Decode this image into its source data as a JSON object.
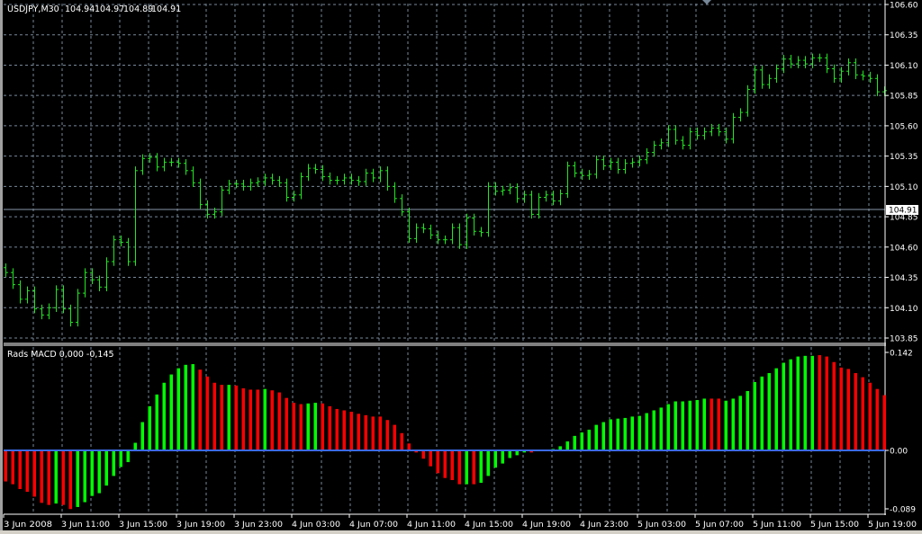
{
  "chart_data": [
    {
      "type": "ohlc",
      "title": "USDJPY,M30",
      "header_values": {
        "open": "104.94",
        "high": "104.97",
        "low": "104.89",
        "close": "104.91"
      },
      "current_price_label": "104.91",
      "current_price": 104.91,
      "ylim": [
        103.85,
        106.6
      ],
      "y_ticks": [
        "106.60",
        "106.35",
        "106.10",
        "105.85",
        "105.60",
        "105.35",
        "105.10",
        "104.85",
        "104.60",
        "104.35",
        "104.10",
        "103.85"
      ],
      "y_tick_values": [
        106.6,
        106.35,
        106.1,
        105.85,
        105.6,
        105.35,
        105.1,
        104.85,
        104.6,
        104.35,
        104.1,
        103.85
      ],
      "grid": true,
      "bar_color": "#22e622",
      "close": [
        104.39,
        104.29,
        104.17,
        104.24,
        104.09,
        104.04,
        104.1,
        104.25,
        104.09,
        103.98,
        104.22,
        104.39,
        104.33,
        104.27,
        104.48,
        104.66,
        104.64,
        104.48,
        105.23,
        105.33,
        105.34,
        105.26,
        105.3,
        105.3,
        105.29,
        105.23,
        105.13,
        104.95,
        104.87,
        104.89,
        105.07,
        105.12,
        105.12,
        105.1,
        105.13,
        105.14,
        105.17,
        105.15,
        105.13,
        105.01,
        105.03,
        105.18,
        105.25,
        105.24,
        105.18,
        105.15,
        105.15,
        105.17,
        105.15,
        105.14,
        105.21,
        105.17,
        105.23,
        105.1,
        105.0,
        104.89,
        104.67,
        104.76,
        104.75,
        104.7,
        104.66,
        104.66,
        104.76,
        104.62,
        104.84,
        104.73,
        104.72,
        105.1,
        105.06,
        105.07,
        105.09,
        105.0,
        105.03,
        104.87,
        105.01,
        105.03,
        104.98,
        105.04,
        105.27,
        105.21,
        105.19,
        105.2,
        105.32,
        105.27,
        105.3,
        105.24,
        105.29,
        105.3,
        105.32,
        105.38,
        105.44,
        105.46,
        105.57,
        105.48,
        105.44,
        105.55,
        105.52,
        105.55,
        105.58,
        105.55,
        105.49,
        105.67,
        105.71,
        105.9,
        106.06,
        105.94,
        105.99,
        106.07,
        106.15,
        106.11,
        106.14,
        106.11,
        106.16,
        106.16,
        106.07,
        105.99,
        106.05,
        106.12,
        106.02,
        106.01,
        105.99,
        105.88,
        105.89
      ]
    },
    {
      "type": "bar",
      "title": "Rads MACD 0,000 -0,145",
      "ylim": [
        -0.089,
        0.142
      ],
      "y_ticks": [
        "0.142",
        "0.00",
        "-0.089"
      ],
      "y_tick_values": [
        0.142,
        0.0,
        -0.089
      ],
      "zero_line_color": "#3c6ae6",
      "up_color": "#00ff00",
      "down_color": "#ff0000",
      "values": [
        -0.045,
        -0.049,
        -0.056,
        -0.06,
        -0.067,
        -0.076,
        -0.079,
        -0.077,
        -0.079,
        -0.085,
        -0.082,
        -0.075,
        -0.066,
        -0.062,
        -0.051,
        -0.037,
        -0.024,
        -0.017,
        0.011,
        0.041,
        0.064,
        0.081,
        0.098,
        0.11,
        0.119,
        0.124,
        0.125,
        0.117,
        0.107,
        0.098,
        0.095,
        0.095,
        0.094,
        0.09,
        0.088,
        0.088,
        0.089,
        0.087,
        0.084,
        0.076,
        0.069,
        0.067,
        0.068,
        0.069,
        0.068,
        0.064,
        0.06,
        0.058,
        0.056,
        0.053,
        0.051,
        0.049,
        0.049,
        0.044,
        0.037,
        0.025,
        0.01,
        -0.003,
        -0.012,
        -0.023,
        -0.033,
        -0.04,
        -0.043,
        -0.049,
        -0.049,
        -0.049,
        -0.047,
        -0.037,
        -0.025,
        -0.019,
        -0.011,
        -0.007,
        -0.003,
        -0.003,
        0.0,
        0.001,
        0.002,
        0.006,
        0.013,
        0.021,
        0.026,
        0.03,
        0.037,
        0.041,
        0.045,
        0.046,
        0.047,
        0.049,
        0.05,
        0.054,
        0.058,
        0.062,
        0.067,
        0.071,
        0.071,
        0.072,
        0.073,
        0.075,
        0.075,
        0.075,
        0.072,
        0.075,
        0.079,
        0.086,
        0.099,
        0.107,
        0.112,
        0.119,
        0.127,
        0.132,
        0.136,
        0.137,
        0.137,
        0.138,
        0.136,
        0.128,
        0.12,
        0.118,
        0.112,
        0.106,
        0.098,
        0.089,
        0.08
      ],
      "colors": "RRRRRRRGRRGGGGGGGGGGGGGGGGGRRRRGRRRRGRRRRRGGRRRRRRRRRRRRRRRRRRRRGRGGGGGGGRGGGGGGGGGGGGGGGGGGGGGGGGRRGGGGGGGGGGGGGRRRRRRRRR"
    }
  ],
  "x_axis": {
    "labels": [
      "3 Jun 2008",
      "3 Jun 11:00",
      "3 Jun 15:00",
      "3 Jun 19:00",
      "3 Jun 23:00",
      "4 Jun 03:00",
      "4 Jun 07:00",
      "4 Jun 11:00",
      "4 Jun 15:00",
      "4 Jun 19:00",
      "4 Jun 23:00",
      "5 Jun 03:00",
      "5 Jun 07:00",
      "5 Jun 11:00",
      "5 Jun 15:00",
      "5 Jun 19:00"
    ],
    "label_every_bars": 8
  }
}
